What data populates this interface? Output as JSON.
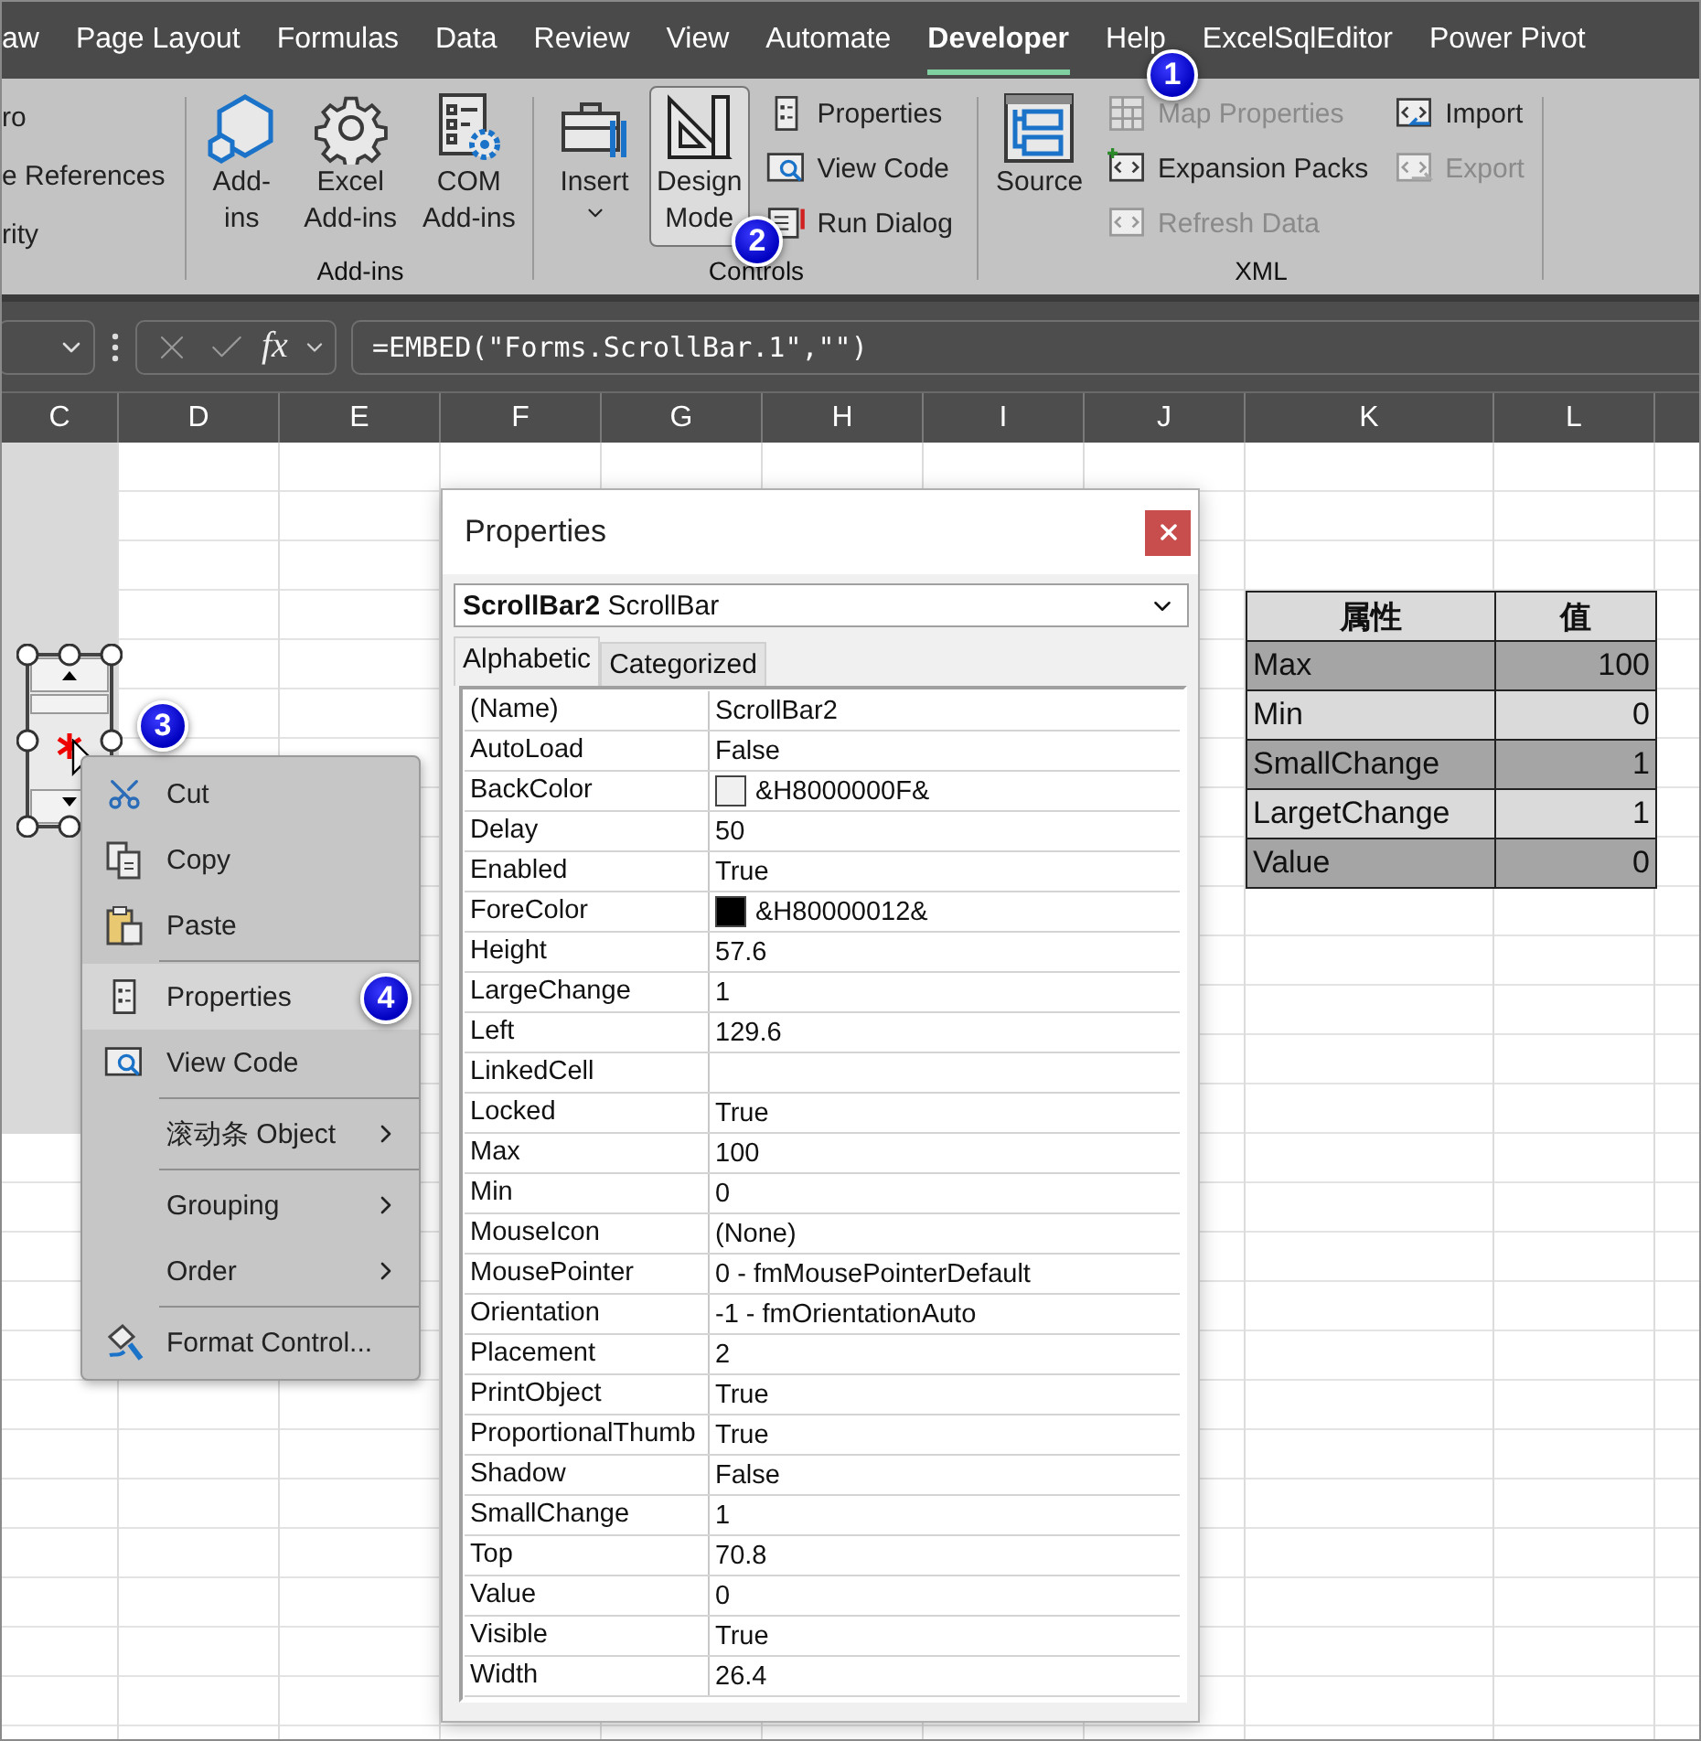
{
  "tabs": [
    {
      "label": "aw",
      "selected": false
    },
    {
      "label": "Page Layout",
      "selected": false
    },
    {
      "label": "Formulas",
      "selected": false
    },
    {
      "label": "Data",
      "selected": false
    },
    {
      "label": "Review",
      "selected": false
    },
    {
      "label": "View",
      "selected": false
    },
    {
      "label": "Automate",
      "selected": false
    },
    {
      "label": "Developer",
      "selected": true
    },
    {
      "label": "Help",
      "selected": false
    },
    {
      "label": "ExcelSqlEditor",
      "selected": false
    },
    {
      "label": "Power Pivot",
      "selected": false
    }
  ],
  "ribbon": {
    "code_items": [
      "ro",
      "e References",
      "rity"
    ],
    "groups": [
      {
        "label": "Add-ins",
        "columns": [
          {
            "kind": "large",
            "buttons": [
              {
                "kind": "addins",
                "lines": [
                  "Add-",
                  "ins"
                ],
                "selected": false,
                "disabled": false
              }
            ]
          },
          {
            "kind": "large",
            "buttons": [
              {
                "kind": "gear",
                "lines": [
                  "Excel",
                  "Add-ins"
                ],
                "selected": false,
                "disabled": false
              }
            ]
          },
          {
            "kind": "large",
            "buttons": [
              {
                "kind": "com",
                "lines": [
                  "COM",
                  "Add-ins"
                ],
                "selected": false,
                "disabled": false
              }
            ]
          }
        ]
      },
      {
        "label": "Controls",
        "columns": [
          {
            "kind": "large",
            "buttons": [
              {
                "kind": "toolbox",
                "lines": [
                  "Insert"
                ],
                "dropdown": true,
                "selected": false,
                "disabled": false
              }
            ]
          },
          {
            "kind": "large",
            "buttons": [
              {
                "kind": "design",
                "lines": [
                  "Design",
                  "Mode"
                ],
                "selected": true,
                "disabled": false
              }
            ]
          },
          {
            "kind": "small",
            "buttons": [
              {
                "kind": "properties",
                "lines": [
                  "Properties"
                ],
                "selected": false,
                "disabled": false
              },
              {
                "kind": "viewcode",
                "lines": [
                  "View Code"
                ],
                "selected": false,
                "disabled": false
              },
              {
                "kind": "dialog",
                "lines": [
                  "Run Dialog"
                ],
                "selected": false,
                "disabled": false
              }
            ]
          }
        ]
      },
      {
        "label": "XML",
        "columns": [
          {
            "kind": "large",
            "buttons": [
              {
                "kind": "source",
                "lines": [
                  "Source"
                ],
                "selected": false,
                "disabled": false
              }
            ]
          },
          {
            "kind": "small",
            "buttons": [
              {
                "kind": "map",
                "lines": [
                  "Map Properties"
                ],
                "selected": false,
                "disabled": true
              },
              {
                "kind": "xmlplus",
                "lines": [
                  "Expansion Packs"
                ],
                "selected": false,
                "disabled": false
              },
              {
                "kind": "xml",
                "lines": [
                  "Refresh Data"
                ],
                "selected": false,
                "disabled": true
              }
            ]
          },
          {
            "kind": "small",
            "buttons": [
              {
                "kind": "import",
                "lines": [
                  "Import"
                ],
                "selected": false,
                "disabled": false
              },
              {
                "kind": "export",
                "lines": [
                  "Export"
                ],
                "selected": false,
                "disabled": true
              }
            ]
          }
        ]
      }
    ]
  },
  "formula_bar": {
    "fx": "fx",
    "formula": "=EMBED(\"Forms.ScrollBar.1\",\"\")"
  },
  "columns": [
    "C",
    "D",
    "E",
    "F",
    "G",
    "H",
    "I",
    "J",
    "K",
    "L"
  ],
  "table": {
    "header": [
      "属性",
      "值"
    ],
    "rows": [
      {
        "name": "Max",
        "value": "100"
      },
      {
        "name": "Min",
        "value": "0"
      },
      {
        "name": "SmallChange",
        "value": "1"
      },
      {
        "name": "LargetChange",
        "value": "1"
      },
      {
        "name": "Value",
        "value": "0"
      }
    ]
  },
  "dialog": {
    "title": "Properties",
    "object": "**ScrollBar2** ScrollBar",
    "tabs": [
      {
        "label": "Alphabetic",
        "selected": true
      },
      {
        "label": "Categorized",
        "selected": false
      }
    ],
    "properties": [
      {
        "name": "(Name)",
        "value": "ScrollBar2"
      },
      {
        "name": "AutoLoad",
        "value": "False"
      },
      {
        "name": "BackColor",
        "value": "&H8000000F&",
        "color": "#f0f0f0"
      },
      {
        "name": "Delay",
        "value": "50"
      },
      {
        "name": "Enabled",
        "value": "True"
      },
      {
        "name": "ForeColor",
        "value": "&H80000012&",
        "color": "#000000"
      },
      {
        "name": "Height",
        "value": "57.6"
      },
      {
        "name": "LargeChange",
        "value": "1"
      },
      {
        "name": "Left",
        "value": "129.6"
      },
      {
        "name": "LinkedCell"
      },
      {
        "name": "Locked",
        "value": "True"
      },
      {
        "name": "Max",
        "value": "100"
      },
      {
        "name": "Min",
        "value": "0"
      },
      {
        "name": "MouseIcon",
        "value": "(None)"
      },
      {
        "name": "MousePointer",
        "value": "0 - fmMousePointerDefault"
      },
      {
        "name": "Orientation",
        "value": "-1 - fmOrientationAuto"
      },
      {
        "name": "Placement",
        "value": "2"
      },
      {
        "name": "PrintObject",
        "value": "True"
      },
      {
        "name": "ProportionalThumb",
        "value": "True"
      },
      {
        "name": "Shadow",
        "value": "False"
      },
      {
        "name": "SmallChange",
        "value": "1"
      },
      {
        "name": "Top",
        "value": "70.8"
      },
      {
        "name": "Value",
        "value": "0"
      },
      {
        "name": "Visible",
        "value": "True"
      },
      {
        "name": "Width",
        "value": "26.4"
      }
    ]
  },
  "context_menu": {
    "sections": [
      [
        {
          "label": "Cut",
          "kind": "cut",
          "submenu": false,
          "selected": false
        },
        {
          "label": "Copy",
          "kind": "copy",
          "submenu": false,
          "selected": false
        },
        {
          "label": "Paste",
          "kind": "paste",
          "submenu": false,
          "selected": false
        }
      ],
      [
        {
          "label": "Properties",
          "kind": "properties",
          "submenu": false,
          "selected": true
        },
        {
          "label": "View Code",
          "kind": "viewcode",
          "submenu": false,
          "selected": false
        }
      ],
      [
        {
          "label": "滚动条 Object",
          "kind": "plain",
          "submenu": true,
          "selected": false
        }
      ],
      [
        {
          "label": "Grouping",
          "kind": "plain",
          "submenu": true,
          "selected": false
        },
        {
          "label": "Order",
          "kind": "plain",
          "submenu": true,
          "selected": false
        }
      ],
      [
        {
          "label": "Format Control...",
          "kind": "format",
          "submenu": false,
          "selected": false
        }
      ]
    ]
  },
  "callouts": [
    "1",
    "2",
    "3",
    "4"
  ]
}
